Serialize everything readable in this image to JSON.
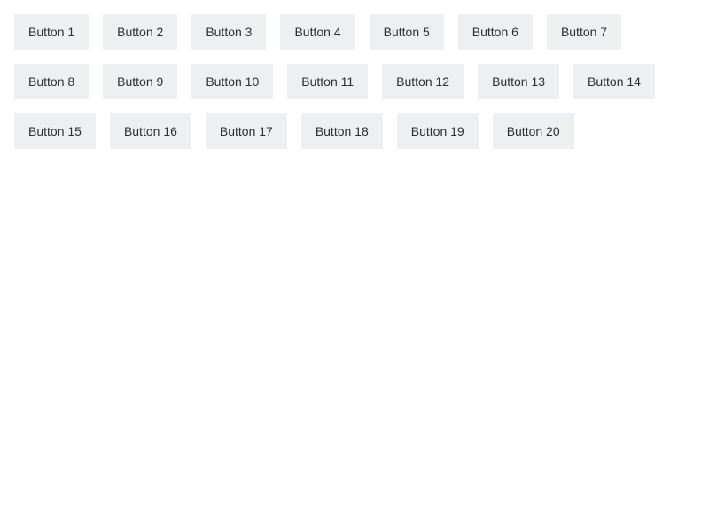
{
  "buttons": [
    {
      "label": "Button 1"
    },
    {
      "label": "Button 2"
    },
    {
      "label": "Button 3"
    },
    {
      "label": "Button 4"
    },
    {
      "label": "Button 5"
    },
    {
      "label": "Button 6"
    },
    {
      "label": "Button 7"
    },
    {
      "label": "Button 8"
    },
    {
      "label": "Button 9"
    },
    {
      "label": "Button 10"
    },
    {
      "label": "Button 11"
    },
    {
      "label": "Button 12"
    },
    {
      "label": "Button 13"
    },
    {
      "label": "Button 14"
    },
    {
      "label": "Button 15"
    },
    {
      "label": "Button 16"
    },
    {
      "label": "Button 17"
    },
    {
      "label": "Button 18"
    },
    {
      "label": "Button 19"
    },
    {
      "label": "Button 20"
    }
  ],
  "colors": {
    "page_background": "#ffffff",
    "button_background": "#eeeff1",
    "button_text": "#2c2f33"
  }
}
